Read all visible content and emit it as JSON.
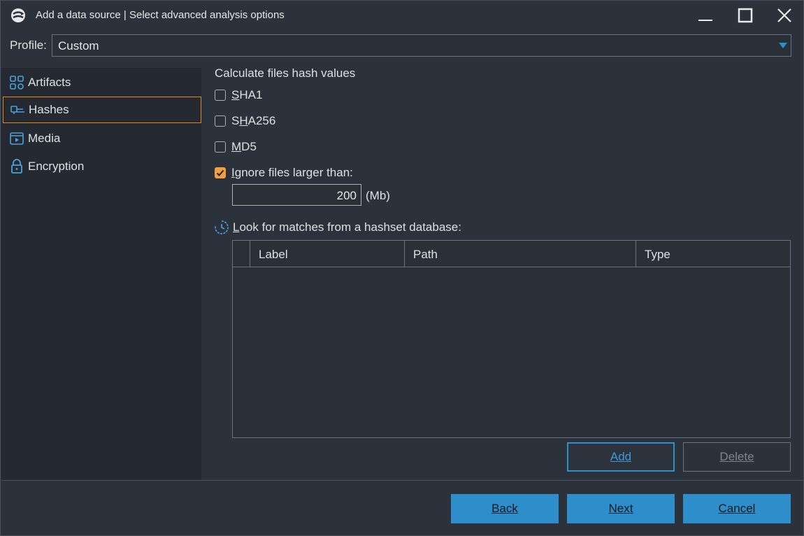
{
  "window": {
    "title": "Add a data source | Select advanced analysis options"
  },
  "profile": {
    "label": "Profile:",
    "value": "Custom"
  },
  "nav": {
    "items": [
      {
        "label": "Artifacts",
        "icon": "artifacts-icon"
      },
      {
        "label": "Hashes",
        "icon": "hashes-icon",
        "selected": true
      },
      {
        "label": "Media",
        "icon": "media-icon"
      },
      {
        "label": "Encryption",
        "icon": "lock-icon"
      }
    ]
  },
  "hashes": {
    "section_title": "Calculate files hash values",
    "sha1": {
      "label_ul": "S",
      "label_rest": "HA1",
      "checked": false
    },
    "sha256": {
      "label_pre": "S",
      "label_ul": "H",
      "label_rest": "A256",
      "checked": false
    },
    "md5": {
      "label_ul": "M",
      "label_rest": "D5",
      "checked": false
    },
    "ignore": {
      "label_ul": "I",
      "label_rest": "gnore files larger than:",
      "checked": true
    },
    "size_value": "200",
    "size_unit": "(Mb)",
    "hashset_label_ul": "L",
    "hashset_label_rest": "ook for matches from a hashset database:"
  },
  "grid": {
    "columns": [
      "Label",
      "Path",
      "Type"
    ],
    "rows": []
  },
  "buttons": {
    "add": "Add",
    "delete": "Delete",
    "back": "Back",
    "next": "Next",
    "cancel": "Cancel"
  },
  "colors": {
    "accent": "#2e8ec9",
    "checked": "#f2a03a",
    "selected_border": "#e08a1e"
  }
}
